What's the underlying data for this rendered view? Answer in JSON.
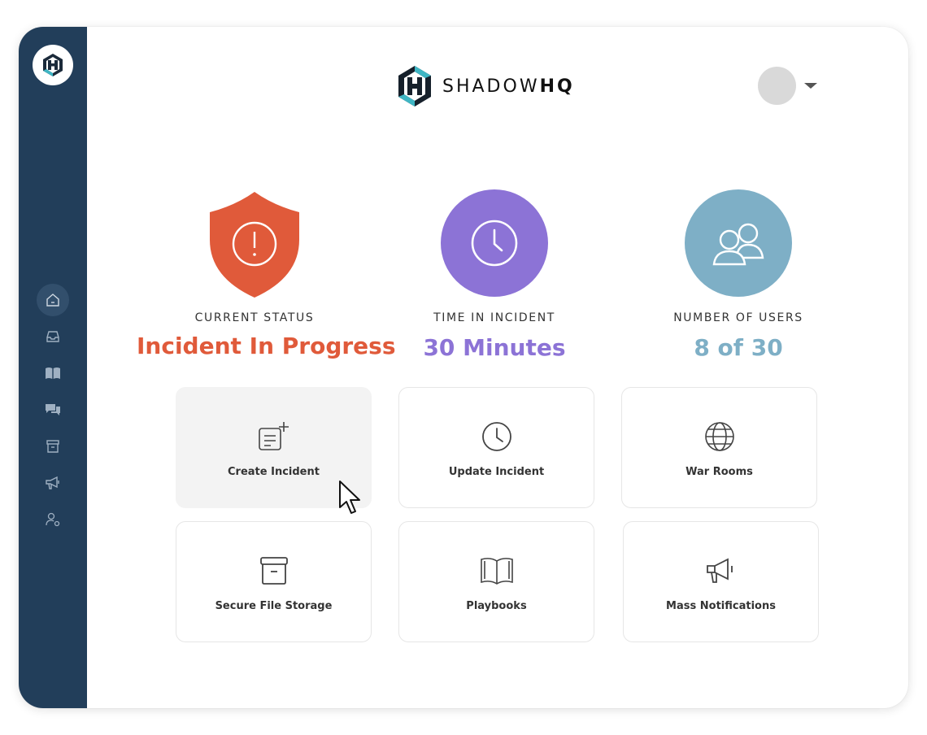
{
  "brand": {
    "name_light": "SHADOW",
    "name_bold": "HQ"
  },
  "sidebar": {
    "items": [
      {
        "icon": "home-icon",
        "active": true
      },
      {
        "icon": "inbox-icon",
        "active": false
      },
      {
        "icon": "book-icon",
        "active": false
      },
      {
        "icon": "chat-icon",
        "active": false
      },
      {
        "icon": "archive-icon",
        "active": false
      },
      {
        "icon": "megaphone-icon",
        "active": false
      },
      {
        "icon": "user-settings-icon",
        "active": false
      }
    ]
  },
  "stats": {
    "status": {
      "label": "CURRENT STATUS",
      "value": "Incident In Progress",
      "color": "#e05a3a"
    },
    "time": {
      "label": "TIME IN INCIDENT",
      "value": "30 Minutes",
      "color": "#8c73d6"
    },
    "users": {
      "label": "NUMBER OF USERS",
      "value": "8 of 30",
      "color": "#7eafc6"
    }
  },
  "cards": [
    {
      "label": "Create Incident",
      "icon": "create-incident-icon"
    },
    {
      "label": "Update Incident",
      "icon": "clock-icon"
    },
    {
      "label": "War Rooms",
      "icon": "globe-icon"
    },
    {
      "label": "Secure File Storage",
      "icon": "archive-box-icon"
    },
    {
      "label": "Playbooks",
      "icon": "open-book-icon"
    },
    {
      "label": "Mass Notifications",
      "icon": "megaphone-icon"
    }
  ],
  "colors": {
    "sidebar": "#223e5a",
    "accent_teal": "#3fb6c4"
  }
}
